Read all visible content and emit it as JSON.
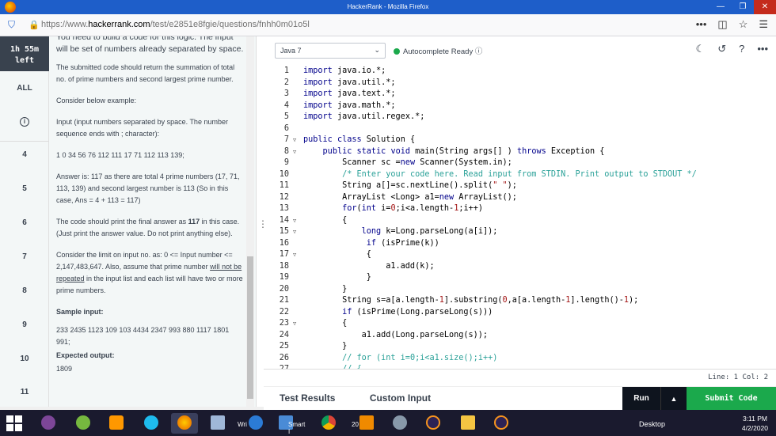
{
  "browser": {
    "window_title": "HackerRank - Mozilla Firefox",
    "url_prefix": "https://www.",
    "url_host": "hackerrank.com",
    "url_path": "/test/e2851e8fgie/questions/fnhh0m01o5l",
    "icons": [
      "shield-icon",
      "lock-icon",
      "more-icon",
      "pocket-icon",
      "star-icon",
      "menu-icon"
    ]
  },
  "timer": {
    "value": "1h 55m",
    "label": "left"
  },
  "qnav": {
    "all": "ALL",
    "info": "i",
    "numbers": [
      "4",
      "5",
      "6",
      "7",
      "8",
      "9",
      "10",
      "11"
    ]
  },
  "problem": {
    "intro": "You need to build a code for this logic. The input will be set of numbers already separated by space.",
    "p1": "The submitted code should return the summation of total no. of prime numbers and second largest prime number.",
    "p2": "Consider below example:",
    "p3": "Input (input numbers separated by space. The number sequence ends with ; character):",
    "p4": "1 0 34 56 76 112 111 17 71 112 113 139;",
    "p5": "Answer is: 117 as there are total 4 prime numbers (17, 71, 113, 139) and second largest number is 113 (So in this case, Ans = 4 + 113 = 117)",
    "p6a": "The code should print the final answer as ",
    "p6b": "117",
    "p6c": " in this case. (Just print the answer value. Do not print anything else).",
    "p7a": "Consider the limit on input no. as: 0 <= Input number <= 2,147,483,647. Also, assume that prime number ",
    "p7b": "will not be repeated",
    "p7c": " in the input list and each list will have two or more prime numbers.",
    "sample_input_label": "Sample input:",
    "sample_input": "233 2435 1123 109 103 4434 2347 993 880 1117 1801 991;",
    "expected_output_label": "Expected output:",
    "expected_output": "1809"
  },
  "toolbar": {
    "language": "Java 7",
    "autocomplete": "Autocomplete Ready",
    "icons": [
      "moon-icon",
      "history-icon",
      "help-icon",
      "more-icon"
    ]
  },
  "editor": {
    "lines": [
      "import java.io.*;",
      "import java.util.*;",
      "import java.text.*;",
      "import java.math.*;",
      "import java.util.regex.*;",
      "",
      "public class Solution {",
      "    public static void main(String args[] ) throws Exception {",
      "        Scanner sc =new Scanner(System.in);",
      "        /* Enter your code here. Read input from STDIN. Print output to STDOUT */",
      "        String a[]=sc.nextLine().split(\" \");",
      "        ArrayList <Long> a1=new ArrayList();",
      "        for(int i=0;i<a.length-1;i++)",
      "        {",
      "            long k=Long.parseLong(a[i]);",
      "             if (isPrime(k))",
      "             {",
      "                 a1.add(k);",
      "             }",
      "        }",
      "        String s=a[a.length-1].substring(0,a[a.length-1].length()-1);",
      "        if (isPrime(Long.parseLong(s)))",
      "        {",
      "            a1.add(Long.parseLong(s));",
      "        }",
      "        // for (int i=0;i<a1.size();i++)",
      "        // {"
    ]
  },
  "status": {
    "position": "Line: 1 Col: 2"
  },
  "bottom": {
    "tab_results": "Test Results",
    "tab_custom": "Custom Input",
    "run": "Run",
    "up": "▲",
    "submit": "Submit Code"
  },
  "taskbar": {
    "apps": [
      "tor-icon",
      "utorrent-icon",
      "sublime-icon",
      "ie-icon",
      "firefox-icon",
      "app-icon",
      "wri-icon",
      "smart-icon",
      "chrome-icon",
      "vlc-icon",
      "tool-icon",
      "eclipse-icon",
      "explorer-icon",
      "eclipse2-icon"
    ],
    "label_wri": "Wri",
    "label_smart": "Smart I",
    "label_20": "20",
    "desktop": "Desktop",
    "time": "3:11 PM",
    "date": "4/2/2020"
  }
}
